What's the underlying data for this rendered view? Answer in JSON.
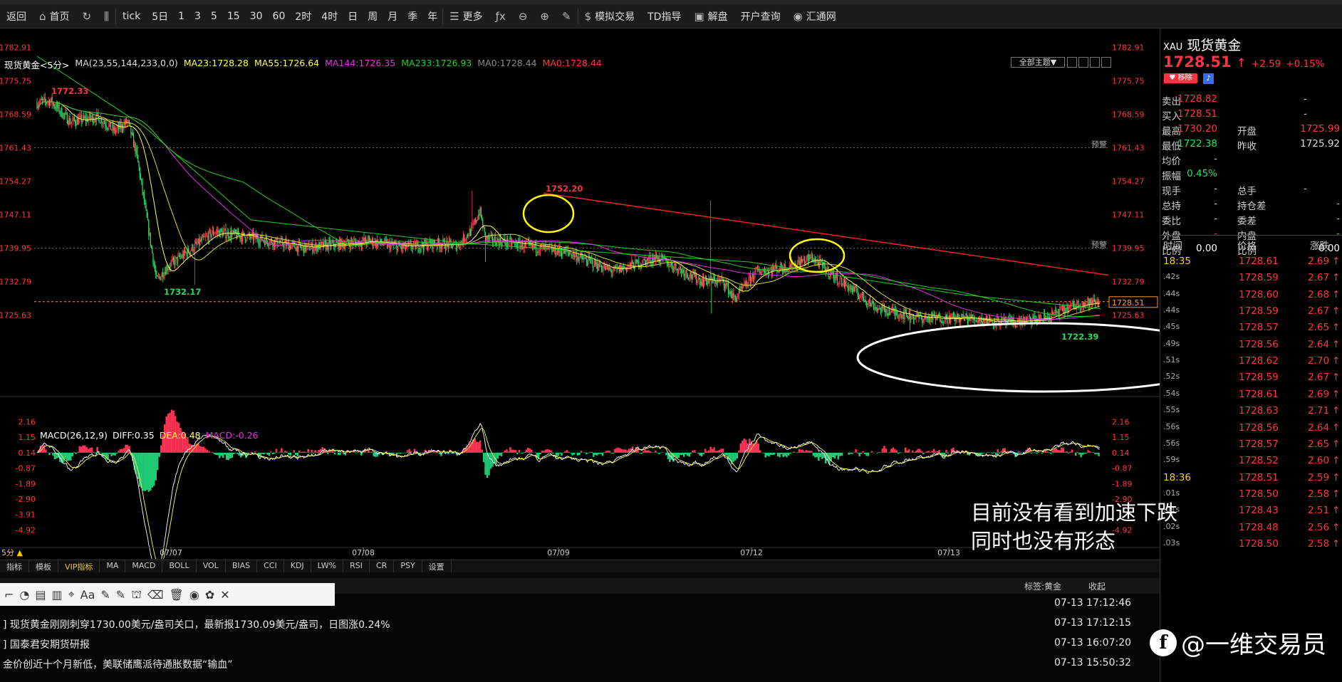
{
  "toolbar": {
    "items": [
      {
        "name": "back-button",
        "label": "返回",
        "icon": ""
      },
      {
        "name": "home-button",
        "label": "首页",
        "icon": "⌂"
      },
      {
        "name": "refresh-button",
        "label": "",
        "icon": "↻"
      },
      {
        "name": "kline-type-button",
        "label": "",
        "icon": "⫼"
      },
      {
        "name": "tick-button",
        "label": "tick",
        "icon": ""
      },
      {
        "name": "period-5d-button",
        "label": "5日",
        "icon": ""
      },
      {
        "name": "period-1-button",
        "label": "1",
        "icon": ""
      },
      {
        "name": "period-3-button",
        "label": "3",
        "icon": ""
      },
      {
        "name": "period-5-button",
        "label": "5",
        "icon": ""
      },
      {
        "name": "period-15-button",
        "label": "15",
        "icon": ""
      },
      {
        "name": "period-30-button",
        "label": "30",
        "icon": ""
      },
      {
        "name": "period-60-button",
        "label": "60",
        "icon": ""
      },
      {
        "name": "period-2h-button",
        "label": "2时",
        "icon": ""
      },
      {
        "name": "period-4h-button",
        "label": "4时",
        "icon": ""
      },
      {
        "name": "period-day-button",
        "label": "日",
        "icon": ""
      },
      {
        "name": "period-week-button",
        "label": "周",
        "icon": ""
      },
      {
        "name": "period-month-button",
        "label": "月",
        "icon": ""
      },
      {
        "name": "period-season-button",
        "label": "季",
        "icon": ""
      },
      {
        "name": "period-year-button",
        "label": "年",
        "icon": ""
      },
      {
        "name": "more-button",
        "label": "更多",
        "icon": "☰"
      },
      {
        "name": "formula-button",
        "label": "",
        "icon": "ƒx"
      },
      {
        "name": "zoom-out-button",
        "label": "",
        "icon": "⊖"
      },
      {
        "name": "zoom-in-button",
        "label": "",
        "icon": "⊕"
      },
      {
        "name": "draw-button",
        "label": "",
        "icon": "✎"
      },
      {
        "name": "sim-trade-button",
        "label": "模拟交易",
        "icon": "$"
      },
      {
        "name": "td-guide-button",
        "label": "TD指导",
        "icon": ""
      },
      {
        "name": "analysis-button",
        "label": "解盘",
        "icon": "▣"
      },
      {
        "name": "open-account-button",
        "label": "开户查询",
        "icon": ""
      },
      {
        "name": "huitong-button",
        "label": "汇通网",
        "icon": "◉"
      }
    ]
  },
  "chart": {
    "legend": {
      "symbol": "现货黄金<5分>",
      "ma_params": "MA(23,55,144,233,0,0)",
      "ma23": "MA23:1728.28",
      "ma55": "MA55:1726.64",
      "ma144": "MA144:1726.35",
      "ma233": "MA233:1726.93",
      "ma0a": "MA0:1728.44",
      "ma0b": "MA0:1728.44"
    },
    "theme_button": "全部主题▼",
    "price_ticks": [
      "1782.91",
      "1775.75",
      "1768.59",
      "1761.43",
      "1754.27",
      "1747.11",
      "1739.95",
      "1732.79",
      "1725.63"
    ],
    "price_values": [
      1782.91,
      1775.75,
      1768.59,
      1761.43,
      1754.27,
      1747.11,
      1739.95,
      1732.79,
      1725.63
    ],
    "ylim": [
      1719.5,
      1784.5
    ],
    "labels": {
      "high_left": "1772.33",
      "low_left": "1732.17",
      "peak": "1752.20",
      "low_right": "1722.39",
      "current": "1728.51",
      "warn": "预警"
    },
    "current_price": 1728.51,
    "warn_levels": [
      1761.43,
      1739.95
    ],
    "date_labels": [
      "07/07",
      "07/08",
      "07/09",
      "07/12",
      "07/13"
    ],
    "period_label": "5分 ▲"
  },
  "macd": {
    "legend": {
      "params": "MACD(26,12,9)",
      "diff": "DIFF:0.35",
      "dea": "DEA:0.48",
      "macd": "MACD:-0.26"
    },
    "ticks": [
      "2.16",
      "1.15",
      "0.14",
      "-0.87",
      "-1.89",
      "-2.90",
      "-3.91",
      "-4.92"
    ],
    "tick_values": [
      2.16,
      1.15,
      0.14,
      -0.87,
      -1.89,
      -2.9,
      -3.91,
      -4.92
    ],
    "right_ticks": [
      "2.16",
      "1.15",
      "0.14",
      "-0.87",
      "-1.89",
      "-2.90",
      "-4.92"
    ],
    "right_tick_values": [
      2.16,
      1.15,
      0.14,
      -0.87,
      -1.89,
      -2.9,
      -4.92
    ],
    "ylim": [
      -5.7,
      2.7
    ]
  },
  "indicator_tabs": [
    "指标",
    "模板",
    "VIP指标",
    "MA",
    "MACD",
    "BOLL",
    "VOL",
    "BIAS",
    "CCI",
    "KDJ",
    "LW%",
    "RSI",
    "CR",
    "PSY",
    "设置"
  ],
  "drawing_tools": [
    "⌐",
    "◔",
    "▤",
    "▥",
    "⌖",
    "Aa",
    "✎",
    "✎",
    "⛫",
    "⌫",
    "🗑",
    "◉",
    "✿",
    "✕"
  ],
  "news": {
    "header_tag": "标签:黄金",
    "collapse": "收起",
    "items": [
      {
        "text": "",
        "time": "07-13 17:12:46"
      },
      {
        "text": "] 现货黄金刚刚刺穿1730.00美元/盎司关口，最新报1730.09美元/盎司，日图涨0.24%",
        "time": "07-13 17:12:15"
      },
      {
        "text": "] 国泰君安期货研报",
        "time": "07-13 16:07:20"
      },
      {
        "text": "金价创近十个月新低，美联储鹰派待通胀数据“输血”",
        "time": "07-13 15:50:32"
      }
    ]
  },
  "quote": {
    "code": "XAU",
    "name": "现货黄金",
    "price": "1728.51",
    "arrow": "↑",
    "change": "+2.59",
    "change_pct": "+0.15%",
    "remove_btn": "♥ 移除",
    "sell_label": "卖出",
    "sell": "1728.82",
    "sell_vol": "-",
    "buy_label": "买入",
    "buy": "1728.51",
    "buy_vol": "-",
    "high_label": "最高",
    "high": "1730.20",
    "open_label": "开盘",
    "open": "1725.99",
    "low_label": "最低",
    "low": "1722.38",
    "prev_label": "昨收",
    "prev": "1725.92",
    "avg_label": "均价",
    "avg": "-",
    "amp_label": "振幅",
    "amp": "0.45%",
    "cur_vol_label": "现手",
    "cur_vol": "-",
    "tot_vol_label": "总手",
    "tot_vol": "-",
    "tot_hold_label": "总持",
    "tot_hold": "-",
    "hold_chg_label": "持仓差",
    "hold_chg": "-",
    "weibi_label": "委比",
    "weibi": "-",
    "weicha_label": "委差",
    "weicha": "-",
    "outer_label": "外盘",
    "outer": "-",
    "inner_label": "内盘",
    "inner": "-",
    "ratio1_label": "比例",
    "ratio1": "0.00",
    "ratio2_label": "比例",
    "ratio2": "0.00",
    "col_time": "时间",
    "col_price": "价格",
    "col_chg": "涨跌"
  },
  "ticks": [
    {
      "time": "18:35",
      "price": "1728.61",
      "chg": "2.69"
    },
    {
      "time": ".42s",
      "price": "1728.59",
      "chg": "2.67"
    },
    {
      "time": ".44s",
      "price": "1728.60",
      "chg": "2.68"
    },
    {
      "time": ".44s",
      "price": "1728.59",
      "chg": "2.67"
    },
    {
      "time": ".45s",
      "price": "1728.57",
      "chg": "2.65"
    },
    {
      "time": ".49s",
      "price": "1728.56",
      "chg": "2.64"
    },
    {
      "time": ".51s",
      "price": "1728.62",
      "chg": "2.70"
    },
    {
      "time": ".52s",
      "price": "1728.59",
      "chg": "2.67"
    },
    {
      "time": ".54s",
      "price": "1728.61",
      "chg": "2.69"
    },
    {
      "time": ".55s",
      "price": "1728.63",
      "chg": "2.71"
    },
    {
      "time": ".56s",
      "price": "1728.56",
      "chg": "2.64"
    },
    {
      "time": ".56s",
      "price": "1728.57",
      "chg": "2.65"
    },
    {
      "time": ".59s",
      "price": "1728.52",
      "chg": "2.60"
    },
    {
      "time": "18:36",
      "price": "1728.51",
      "chg": "2.59"
    },
    {
      "time": ".01s",
      "price": "1728.50",
      "chg": "2.58"
    },
    {
      "time": ".01s",
      "price": "1728.43",
      "chg": "2.51"
    },
    {
      "time": ".02s",
      "price": "1728.48",
      "chg": "2.56"
    },
    {
      "time": ".03s",
      "price": "1728.50",
      "chg": "2.58"
    }
  ],
  "annotation": {
    "line1": "目前没有看到加速下跌",
    "line2": "同时也没有形态"
  },
  "watermark": {
    "logo": "f",
    "text": "@一维交易员"
  },
  "colors": {
    "up": "#ff3344",
    "down": "#22dd66",
    "ma23": "#ffff55",
    "ma55": "#22cc22",
    "ma144": "#dd33dd",
    "trend": "#ff2222",
    "circle": "#ffff00",
    "ellipse": "#ffffff"
  }
}
